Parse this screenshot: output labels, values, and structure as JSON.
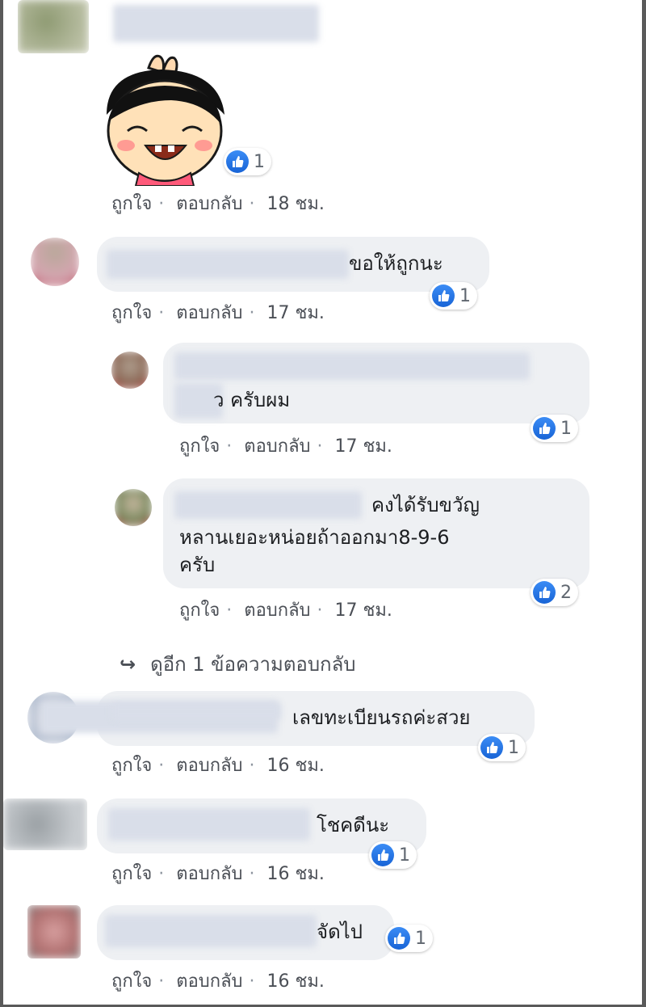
{
  "comments": [
    {
      "text": "",
      "reactions": "1",
      "like": "ถูกใจ",
      "reply": "ตอบกลับ",
      "time": "18 ชม."
    },
    {
      "text": "ขอให้ถูกนะ",
      "reactions": "1",
      "like": "ถูกใจ",
      "reply": "ตอบกลับ",
      "time": "17 ชม."
    },
    {
      "text": "ว ครับผม",
      "reactions": "1",
      "like": "ถูกใจ",
      "reply": "ตอบกลับ",
      "time": "17 ชม."
    },
    {
      "text_line1": "คงได้รับขวัญ",
      "text_line2": "หลานเยอะหน่อยถ้าออกมา8-9-6",
      "text_line3": "ครับ",
      "reactions": "2",
      "like": "ถูกใจ",
      "reply": "ตอบกลับ",
      "time": "17 ชม."
    },
    {
      "text": "เลขทะเบียนรถค่ะสวย",
      "reactions": "1",
      "like": "ถูกใจ",
      "reply": "ตอบกลับ",
      "time": "16 ชม."
    },
    {
      "text": "โชคดีนะ",
      "reactions": "1",
      "like": "ถูกใจ",
      "reply": "ตอบกลับ",
      "time": "16 ชม."
    },
    {
      "text": "จัดไป",
      "reactions": "1",
      "like": "ถูกใจ",
      "reply": "ตอบกลับ",
      "time": "16 ชม."
    }
  ],
  "view_more_replies": "ดูอีก 1 ข้อความตอบกลับ",
  "dot_separator": "·",
  "colors": {
    "like_blue": "#1877f2",
    "bubble": "#eef0f3",
    "meta": "#4b4f56"
  }
}
